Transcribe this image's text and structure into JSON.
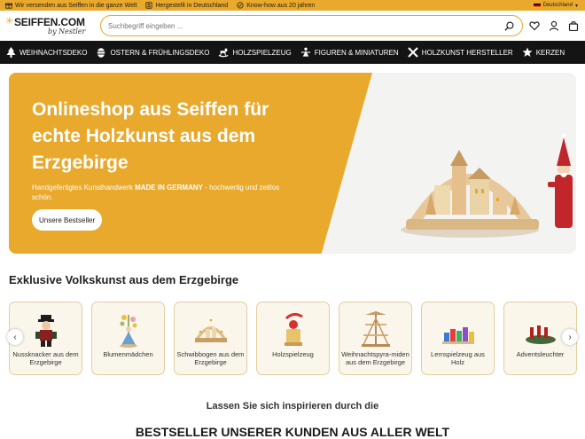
{
  "topbar": {
    "items": [
      {
        "icon": "gift-icon",
        "text": "Wir versenden aus Seiffen in die ganze Welt"
      },
      {
        "icon": "flag-icon",
        "text": "Hergestellt in Deutschland"
      },
      {
        "icon": "check-circle-icon",
        "text": "Know-how aus 20 jahren"
      }
    ],
    "language": "Deutschland"
  },
  "header": {
    "logo_main": "SEIFFEN.COM",
    "logo_sub": "by Nestler",
    "search_placeholder": "Suchbegriff eingeben ...",
    "icons": [
      "search-icon",
      "heart-icon",
      "user-icon",
      "bag-icon"
    ]
  },
  "nav": {
    "items": [
      {
        "icon": "tree-icon",
        "label": "Weihnachtsdeko"
      },
      {
        "icon": "egg-icon",
        "label": "Ostern & Frühlingsdeko"
      },
      {
        "icon": "rocking-horse-icon",
        "label": "Holzspielzeug"
      },
      {
        "icon": "figure-icon",
        "label": "Figuren & Miniaturen"
      },
      {
        "icon": "tools-icon",
        "label": "Holzkunst Hersteller"
      },
      {
        "icon": "star-icon",
        "label": "Kerzen"
      }
    ]
  },
  "hero": {
    "title": "Onlineshop aus Seiffen für echte Holzkunst aus dem Erzgebirge",
    "subtitle_pre": "Handgefertigtes Kunsthandwerk ",
    "subtitle_bold": "MADE IN GERMANY",
    "subtitle_post": " - hochwertig und zeitlos schön.",
    "button": "Unsere Bestseller"
  },
  "categories": {
    "title": "Exklusive Volkskunst aus dem Erzgebirge",
    "items": [
      {
        "label": "Nussknacker aus dem Erzgebirge"
      },
      {
        "label": "Blumenmädchen"
      },
      {
        "label": "Schwibbogen aus dem Erzgebirge"
      },
      {
        "label": "Holzspielzeug"
      },
      {
        "label": "Weihnachtspyra-miden aus dem Erzgebirge"
      },
      {
        "label": "Lernspielzeug aus Holz"
      },
      {
        "label": "Adventsleuchter"
      }
    ]
  },
  "inspire": "Lassen Sie sich inspirieren durch die",
  "bestseller": "Bestseller unserer Kunden aus aller Welt",
  "colors": {
    "accent": "#e8a92c",
    "nav_bg": "#141414"
  }
}
